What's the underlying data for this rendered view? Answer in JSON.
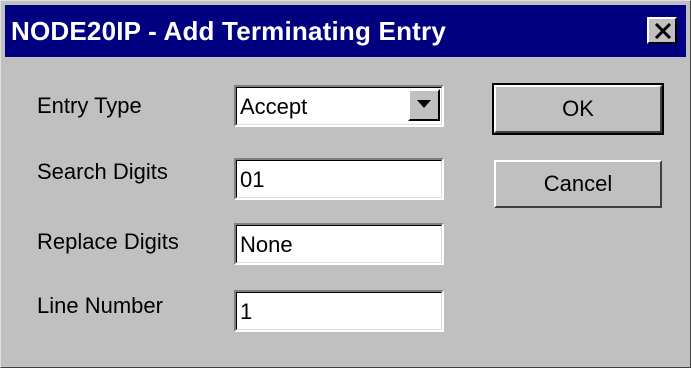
{
  "window": {
    "title": "NODE20IP - Add Terminating Entry"
  },
  "form": {
    "entry_type": {
      "label": "Entry Type",
      "value": "Accept"
    },
    "search_digits": {
      "label": "Search Digits",
      "value": "01"
    },
    "replace_digits": {
      "label": "Replace Digits",
      "value": "None"
    },
    "line_number": {
      "label": "Line Number",
      "value": "1"
    }
  },
  "buttons": {
    "ok_label": "OK",
    "cancel_label": "Cancel"
  },
  "icons": {
    "close": "close-icon",
    "dropdown": "chevron-down-icon"
  },
  "colors": {
    "title_bar": "#000080",
    "dialog_face": "#c0c0c0"
  }
}
